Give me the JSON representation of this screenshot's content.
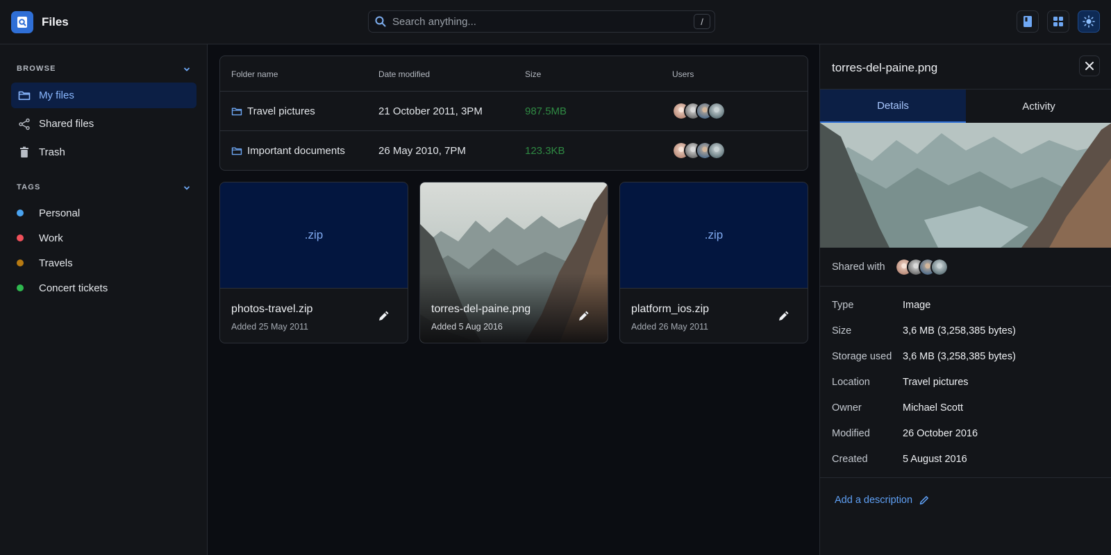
{
  "app": {
    "title": "Files"
  },
  "search": {
    "placeholder": "Search anything...",
    "shortcut": "/"
  },
  "header_buttons": [
    {
      "icon": "book-icon"
    },
    {
      "icon": "grid-view-icon"
    },
    {
      "icon": "sun-icon",
      "active": true
    }
  ],
  "sidebar": {
    "browse_heading": "BROWSE",
    "browse": [
      {
        "label": "My files",
        "icon": "folder-icon",
        "active": true
      },
      {
        "label": "Shared files",
        "icon": "share-icon"
      },
      {
        "label": "Trash",
        "icon": "trash-icon"
      }
    ],
    "tags_heading": "TAGS",
    "tags": [
      {
        "label": "Personal",
        "color": "#4aa3f0"
      },
      {
        "label": "Work",
        "color": "#f0505a"
      },
      {
        "label": "Travels",
        "color": "#b77a12"
      },
      {
        "label": "Concert tickets",
        "color": "#2fb84f"
      }
    ]
  },
  "folders": {
    "columns": [
      "Folder name",
      "Date modified",
      "Size",
      "Users"
    ],
    "rows": [
      {
        "name": "Travel pictures",
        "date": "21 October 2011, 3PM",
        "size": "987.5MB"
      },
      {
        "name": "Important documents",
        "date": "26 May 2010, 7PM",
        "size": "123.3KB"
      }
    ]
  },
  "files": [
    {
      "thumb": ".zip",
      "name": "photos-travel.zip",
      "added": "Added 25 May 2011"
    },
    {
      "thumb": "",
      "name": "torres-del-paine.png",
      "added": "Added 5 Aug 2016"
    },
    {
      "thumb": ".zip",
      "name": "platform_ios.zip",
      "added": "Added 26 May 2011"
    }
  ],
  "details": {
    "title": "torres-del-paine.png",
    "tabs": [
      "Details",
      "Activity"
    ],
    "shared_with": "Shared with",
    "fields": [
      {
        "key": "Type",
        "value": "Image"
      },
      {
        "key": "Size",
        "value": "3,6 MB (3,258,385 bytes)"
      },
      {
        "key": "Storage used",
        "value": "3,6 MB (3,258,385 bytes)"
      },
      {
        "key": "Location",
        "value": "Travel pictures"
      },
      {
        "key": "Owner",
        "value": "Michael Scott"
      },
      {
        "key": "Modified",
        "value": "26 October 2016"
      },
      {
        "key": "Created",
        "value": "5 August 2016"
      }
    ],
    "add_description": "Add a description"
  },
  "colors": {
    "accent": "#2f6fd6",
    "size_text": "#2f8a43",
    "link": "#5fa0f5"
  }
}
